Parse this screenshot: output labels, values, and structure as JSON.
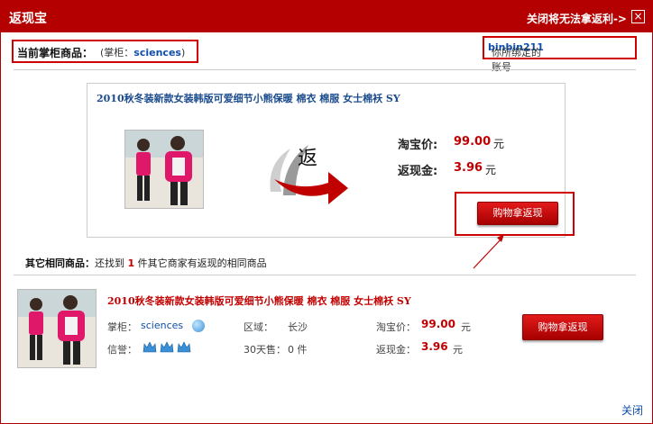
{
  "window": {
    "title": "返现宝",
    "close_hint": "关闭将无法拿返利->",
    "close_symbol": "×",
    "footer_close": "关闭"
  },
  "current": {
    "label": "当前掌柜商品：",
    "keeper_prefix": "(掌柜：",
    "keeper": "sciences",
    "keeper_suffix": ")"
  },
  "account": {
    "prefix": "你所绑定的账号",
    "name": "binbin211"
  },
  "main_product": {
    "title": "2010秋冬装新款女装韩版可爱细节小熊保暖 棉衣 棉服 女士棉袄 SY",
    "return_char": "返",
    "taobao_price_label": "淘宝价:",
    "taobao_price": "99.00",
    "cashback_label": "返现金:",
    "cashback": "3.96",
    "unit": "元",
    "buy_button": "购物拿返现"
  },
  "other": {
    "label": "其它相同商品：",
    "found_prefix": "还找到 ",
    "count": "1",
    "found_suffix": " 件其它商家有返现的相同商品"
  },
  "other_item": {
    "title": "2010秋冬装新款女装韩版可爱细节小熊保暖 棉衣 棉服 女士棉袄 SY",
    "keeper_label": "掌柜：",
    "keeper": "sciences",
    "region_label": "区域：",
    "region": "长沙",
    "taobao_price_label": "淘宝价：",
    "taobao_price": "99.00",
    "unit": "元",
    "credit_label": "信誉：",
    "sales_label": "30天售：",
    "sales": "0 件",
    "cashback_label": "返现金：",
    "cashback": "3.96",
    "buy_button": "购物拿返现"
  },
  "colors": {
    "brand_red": "#b40000",
    "price_red": "#c00000",
    "link_blue": "#0f4ea8"
  }
}
